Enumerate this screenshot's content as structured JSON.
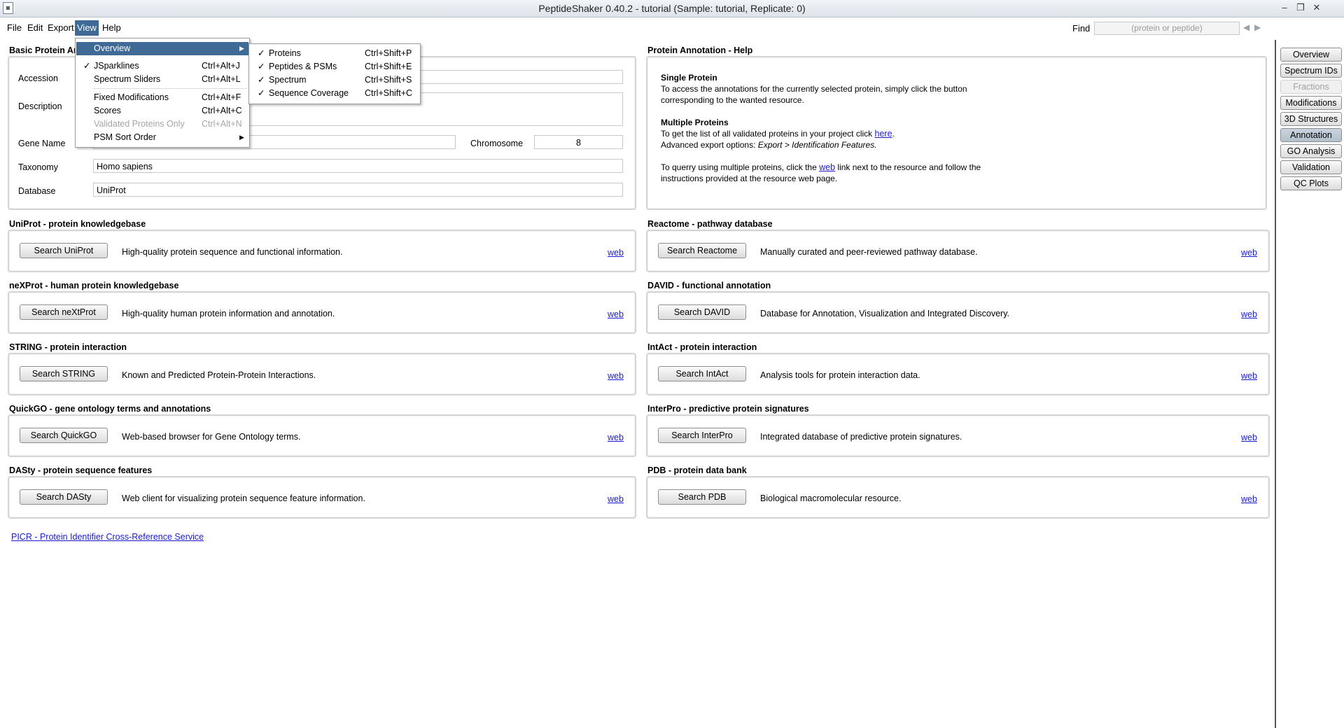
{
  "window": {
    "title": "PeptideShaker 0.40.2 - tutorial (Sample: tutorial, Replicate: 0)"
  },
  "menubar": {
    "file": "File",
    "edit": "Edit",
    "export": "Export",
    "view": "View",
    "help": "Help"
  },
  "find": {
    "label": "Find",
    "placeholder": "(protein or peptide)"
  },
  "basic": {
    "title": "Basic Protein An",
    "accession_label": "Accession",
    "description_label": "Description",
    "gene_label": "Gene Name",
    "chromosome_label": "Chromosome",
    "chromosome_value": "8",
    "taxonomy_label": "Taxonomy",
    "taxonomy_value": "Homo sapiens",
    "database_label": "Database",
    "database_value": "UniProt"
  },
  "help": {
    "title": "Protein Annotation - Help",
    "single_heading": "Single Protein",
    "single_text": "To access the annotations for the currently selected protein, simply click the button corresponding to the wanted resource.",
    "multi_heading": "Multiple Proteins",
    "multi_text1": "To get the list of all validated proteins in your project click",
    "here_link": "here",
    "multi_text2": "Advanced export options:",
    "multi_text2_italic": "Export > Identification Features.",
    "query_text1": "To querry using multiple proteins, click the",
    "web_link": "web",
    "query_text2": "link next to the resource and follow the instructions provided at the resource web page."
  },
  "resources_left": [
    {
      "title": "UniProt - protein knowledgebase",
      "button": "Search UniProt",
      "desc": "High-quality protein sequence and functional information.",
      "link": "web"
    },
    {
      "title": "neXProt - human protein knowledgebase",
      "button": "Search neXtProt",
      "desc": "High-quality human protein information and annotation.",
      "link": "web"
    },
    {
      "title": "STRING - protein interaction",
      "button": "Search STRING",
      "desc": "Known and Predicted Protein-Protein Interactions.",
      "link": "web"
    },
    {
      "title": "QuickGO - gene ontology terms and annotations",
      "button": "Search QuickGO",
      "desc": "Web-based browser for Gene Ontology terms.",
      "link": "web"
    },
    {
      "title": "DASty - protein sequence features",
      "button": "Search DASty",
      "desc": "Web client for visualizing protein sequence feature information.",
      "link": "web"
    }
  ],
  "resources_right": [
    {
      "title": "Reactome - pathway database",
      "button": "Search Reactome",
      "desc": "Manually curated and peer-reviewed pathway database.",
      "link": "web"
    },
    {
      "title": "DAVID - functional annotation",
      "button": "Search DAVID",
      "desc": "Database for Annotation, Visualization and Integrated Discovery.",
      "link": "web"
    },
    {
      "title": "IntAct - protein interaction",
      "button": "Search IntAct",
      "desc": "Analysis tools for protein interaction data.",
      "link": "web"
    },
    {
      "title": "InterPro - predictive protein signatures",
      "button": "Search InterPro",
      "desc": "Integrated database of predictive protein signatures.",
      "link": "web"
    },
    {
      "title": "PDB - protein data bank",
      "button": "Search PDB",
      "desc": "Biological macromolecular resource.",
      "link": "web"
    }
  ],
  "picr_link": "PICR - Protein Identifier Cross-Reference Service",
  "rightnav": [
    "Overview",
    "Spectrum IDs",
    "Fractions",
    "Modifications",
    "3D Structures",
    "Annotation",
    "GO Analysis",
    "Validation",
    "QC Plots"
  ],
  "view_menu": {
    "overview": "Overview",
    "jsparklines": {
      "label": "JSparklines",
      "shortcut": "Ctrl+Alt+J"
    },
    "spectrum_sliders": {
      "label": "Spectrum Sliders",
      "shortcut": "Ctrl+Alt+L"
    },
    "fixed_mods": {
      "label": "Fixed Modifications",
      "shortcut": "Ctrl+Alt+F"
    },
    "scores": {
      "label": "Scores",
      "shortcut": "Ctrl+Alt+C"
    },
    "validated_only": {
      "label": "Validated Proteins Only",
      "shortcut": "Ctrl+Alt+N"
    },
    "psm_sort": "PSM Sort Order"
  },
  "overview_submenu": [
    {
      "label": "Proteins",
      "shortcut": "Ctrl+Shift+P"
    },
    {
      "label": "Peptides & PSMs",
      "shortcut": "Ctrl+Shift+E"
    },
    {
      "label": "Spectrum",
      "shortcut": "Ctrl+Shift+S"
    },
    {
      "label": "Sequence Coverage",
      "shortcut": "Ctrl+Shift+C"
    }
  ],
  "colors": {
    "menu_highlight": "#3e6a95",
    "link": "#1a1ad6",
    "panel_border": "#d4d4d4"
  }
}
